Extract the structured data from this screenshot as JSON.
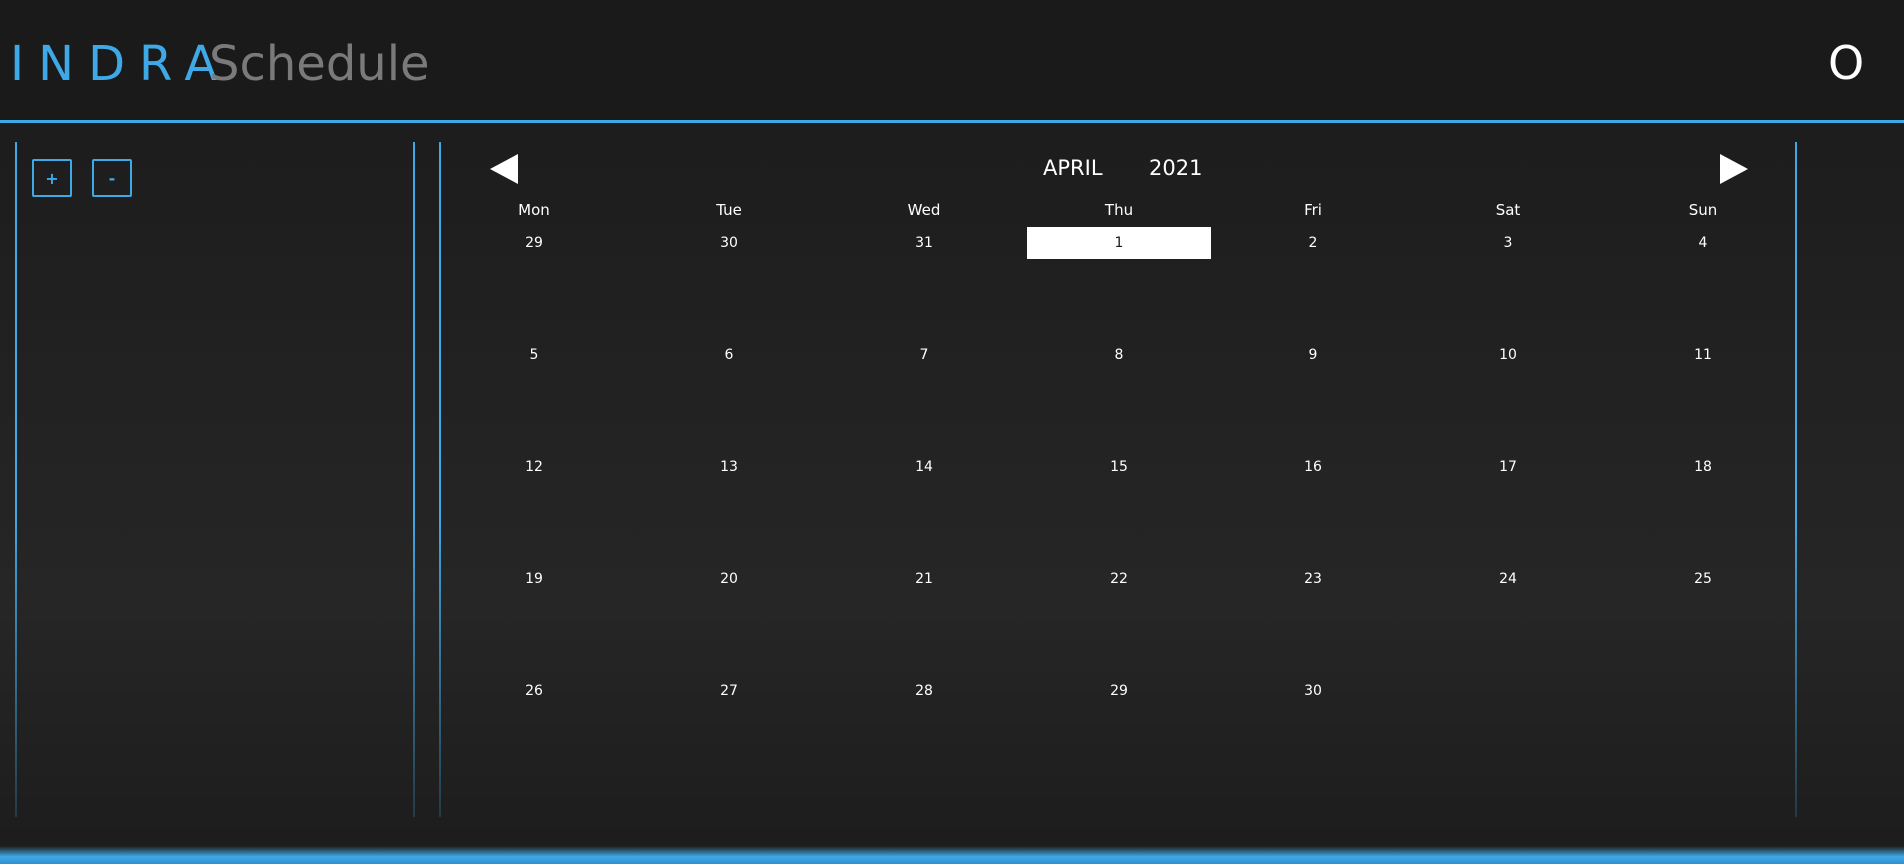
{
  "header": {
    "brand": "INDRA",
    "app_title": "Schedule",
    "user_badge": "O"
  },
  "sidebar": {
    "zoom_in_label": "+",
    "zoom_out_label": "-"
  },
  "calendar": {
    "month": "APRIL",
    "year": "2021",
    "weekdays": [
      "Mon",
      "Tue",
      "Wed",
      "Thu",
      "Fri",
      "Sat",
      "Sun"
    ],
    "weeks": [
      [
        "29",
        "30",
        "31",
        "1",
        "2",
        "3",
        "4"
      ],
      [
        "5",
        "6",
        "7",
        "8",
        "9",
        "10",
        "11"
      ],
      [
        "12",
        "13",
        "14",
        "15",
        "16",
        "17",
        "18"
      ],
      [
        "19",
        "20",
        "21",
        "22",
        "23",
        "24",
        "25"
      ],
      [
        "26",
        "27",
        "28",
        "29",
        "30",
        "",
        ""
      ]
    ],
    "today": "1"
  },
  "colors": {
    "accent": "#3fa9e8",
    "background": "#1b1b1b",
    "title_gray": "#7a7a7a",
    "today_bg": "#ffffff"
  }
}
